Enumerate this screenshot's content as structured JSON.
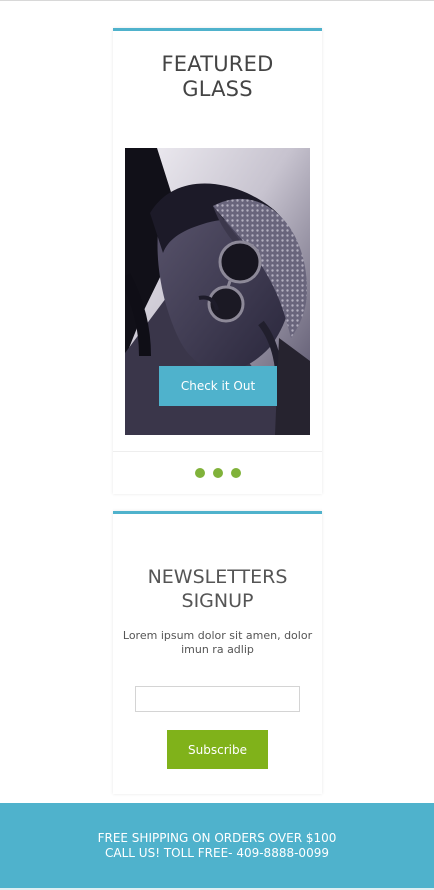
{
  "featured": {
    "title": "FEATURED\nGLASS",
    "button_label": "Check it Out",
    "slider_dots": 3
  },
  "newsletter": {
    "title": "NEWSLETTERS\nSIGNUP",
    "description": "Lorem ipsum dolor sit amen, dolor imun ra adlip",
    "email_value": "",
    "email_placeholder": "",
    "button_label": "Subscribe"
  },
  "footer": {
    "line1": "FREE SHIPPING ON ORDERS OVER $100",
    "line2": "CALL US! TOLL FREE- 409-8888-0099"
  },
  "colors": {
    "accent": "#4fb2cc",
    "green": "#80b21a",
    "text": "#444444"
  }
}
